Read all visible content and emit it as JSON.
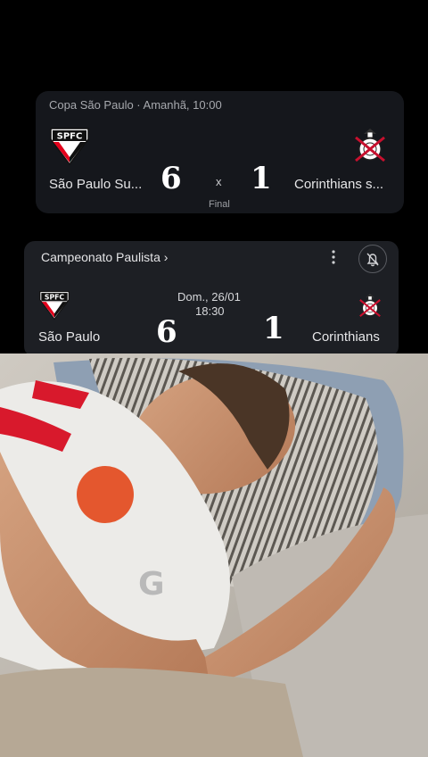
{
  "card_top": {
    "header": "Copa São Paulo · Amanhã, 10:00",
    "home_team": "São Paulo Su...",
    "away_team": "Corinthians s...",
    "home_score": "6",
    "away_score": "1",
    "separator": "x",
    "status": "Final"
  },
  "card_bottom": {
    "header": "Campeonato Paulista ›",
    "date": "Dom., 26/01",
    "time": "18:30",
    "home_team": "São Paulo",
    "away_team": "Corinthians",
    "home_score": "6",
    "away_score": "1"
  },
  "home_crest": {
    "text": "SPFC",
    "icon": "spfc-crest-icon",
    "colors": [
      "#e3001b",
      "#000000",
      "#ffffff"
    ]
  },
  "away_crest": {
    "icon": "corinthians-crest-icon",
    "colors": [
      "#ffffff",
      "#111111",
      "#c8102e"
    ]
  },
  "icons": {
    "menu": "more-vertical-icon",
    "bell": "notifications-off-icon"
  },
  "photo": {
    "description_icon": "man-lying-in-bed-photo",
    "sponsor_text": "LG",
    "colors": {
      "shirt": "#ecebe8",
      "stripe": "#d8192c",
      "pillow": "#8e9aa8",
      "wall": "#c9c5be"
    }
  }
}
